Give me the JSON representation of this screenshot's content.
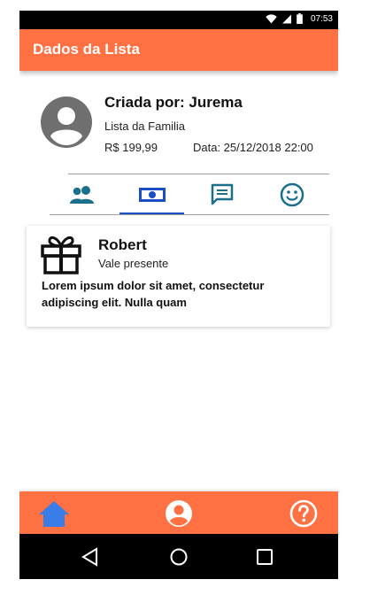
{
  "status_bar": {
    "time": "07:53"
  },
  "app_bar": {
    "title": "Dados da Lista"
  },
  "list_info": {
    "creator": "Criada por: Jurema",
    "list_name": "Lista da Familia",
    "price": "R$ 199,99",
    "date": "Data: 25/12/2018 22:00"
  },
  "tabs": [
    {
      "icon": "people-icon",
      "selected": false
    },
    {
      "icon": "money-icon",
      "selected": true
    },
    {
      "icon": "chat-icon",
      "selected": false
    },
    {
      "icon": "smiley-icon",
      "selected": false
    }
  ],
  "item": {
    "icon": "gift-icon",
    "name": "Robert",
    "type": "Vale presente",
    "description": "Lorem ipsum dolor sit amet, consectetur adipiscing elit. Nulla quam"
  },
  "bottom_nav": [
    {
      "icon": "home-icon",
      "active": true
    },
    {
      "icon": "account-icon",
      "active": false
    },
    {
      "icon": "help-icon",
      "active": false
    }
  ],
  "colors": {
    "primary": "#ff7043",
    "tab_icon": "#1a6f8a",
    "tab_indicator": "#1a4fc4",
    "home_active": "#3b7de8"
  }
}
